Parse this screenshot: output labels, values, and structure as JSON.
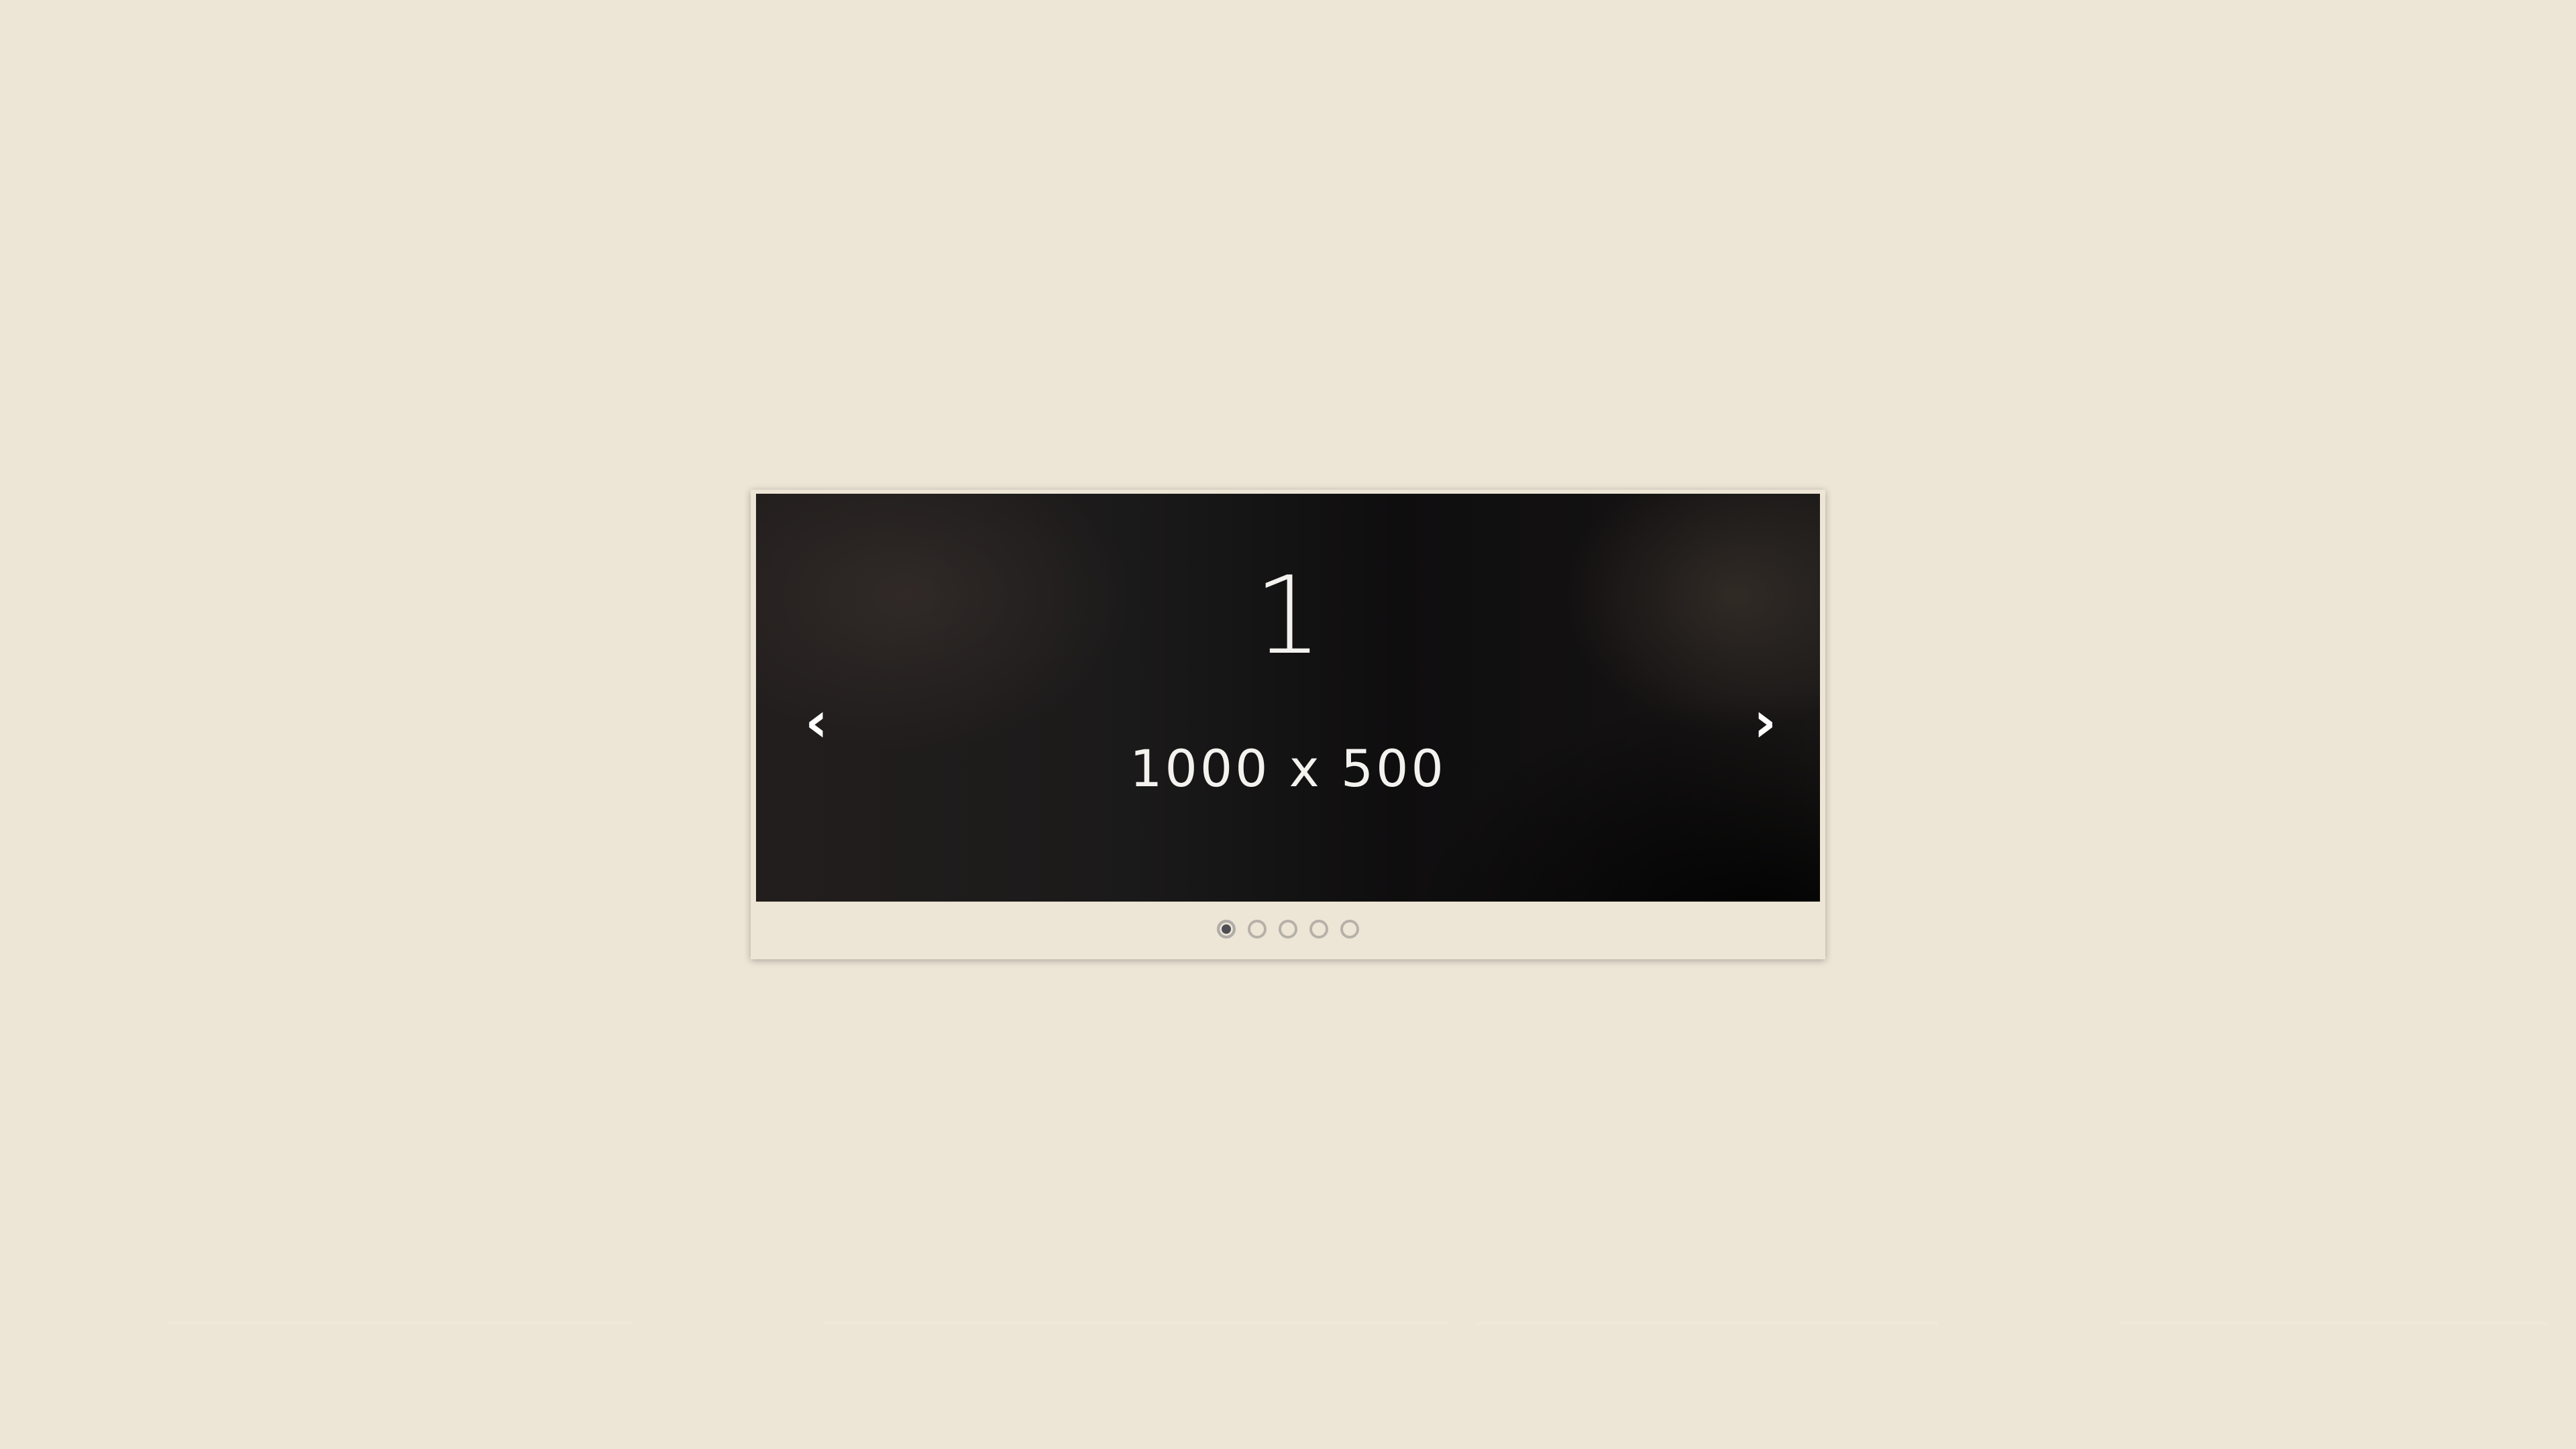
{
  "slider": {
    "slide_number": "1",
    "slide_caption": "1000 x 500",
    "prev_arrow": "‹",
    "next_arrow": "›",
    "dots": [
      {
        "label": "slide 1",
        "active": true
      },
      {
        "label": "slide 2",
        "active": false
      },
      {
        "label": "slide 3",
        "active": false
      },
      {
        "label": "slide 4",
        "active": false
      },
      {
        "label": "slide 5",
        "active": false
      }
    ],
    "current_slide_index": 1,
    "total_slides": 5
  },
  "colors": {
    "page_background": "#ede5d5",
    "slide_background": "#151414",
    "slide_text": "#f4f2ee",
    "dot_active": "#4d4f55",
    "dot_inactive_border": "#b6b1a8"
  }
}
